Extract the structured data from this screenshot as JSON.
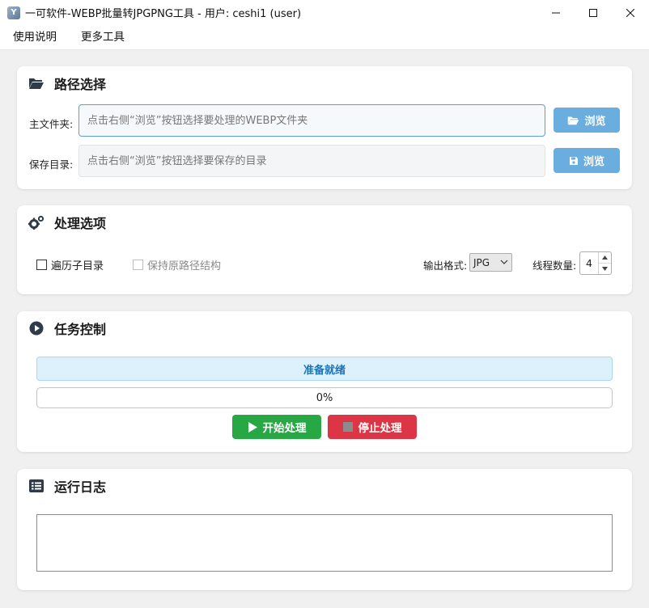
{
  "window": {
    "title": "一可软件-WEBP批量转JPGPNG工具 - 用户: ceshi1 (user)",
    "app_icon": "app-logo-icon"
  },
  "menu": {
    "items": [
      "使用说明",
      "更多工具"
    ]
  },
  "path_section": {
    "title": "路径选择",
    "main_folder_label": "主文件夹:",
    "main_folder_placeholder": "点击右侧“浏览”按钮选择要处理的WEBP文件夹",
    "main_folder_value": "",
    "save_dir_label": "保存目录:",
    "save_dir_placeholder": "点击右侧“浏览”按钮选择要保存的目录",
    "save_dir_value": "",
    "browse_label_1": "浏览",
    "browse_label_2": "浏览"
  },
  "options_section": {
    "title": "处理选项",
    "traverse_subdirs_label": "遍历子目录",
    "traverse_subdirs_checked": false,
    "keep_structure_label": "保持原路径结构",
    "keep_structure_checked": false,
    "keep_structure_enabled": false,
    "output_format_label": "输出格式:",
    "output_format_value": "JPG",
    "thread_count_label": "线程数量:",
    "thread_count_value": "4"
  },
  "task_section": {
    "title": "任务控制",
    "status_text": "准备就绪",
    "progress_percent": 0,
    "progress_text": "0%",
    "start_label": "开始处理",
    "stop_label": "停止处理"
  },
  "log_section": {
    "title": "运行日志",
    "content": ""
  },
  "colors": {
    "accent_blue": "#6aaee0",
    "start_green": "#28a745",
    "stop_red": "#dc3545",
    "status_bg": "#dcf1fb",
    "status_text": "#1a73b8"
  }
}
